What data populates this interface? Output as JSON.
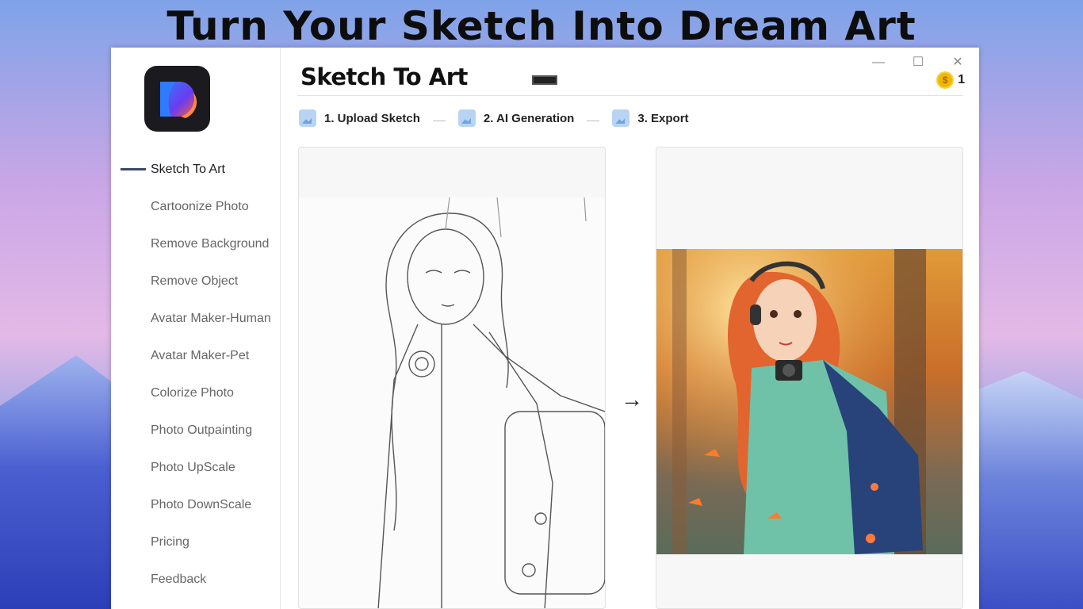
{
  "headline": "Turn Your Sketch Into Dream Art",
  "app": {
    "title": "Sketch To Art",
    "coins": "1",
    "coin_symbol": "$"
  },
  "window_controls": {
    "minimize": "—",
    "maximize": "☐",
    "close": "✕"
  },
  "sidebar": {
    "items": [
      {
        "label": "Sketch To Art",
        "active": true
      },
      {
        "label": "Cartoonize Photo"
      },
      {
        "label": "Remove Background"
      },
      {
        "label": "Remove Object"
      },
      {
        "label": "Avatar Maker-Human"
      },
      {
        "label": "Avatar Maker-Pet"
      },
      {
        "label": "Colorize Photo"
      },
      {
        "label": "Photo Outpainting"
      },
      {
        "label": "Photo UpScale"
      },
      {
        "label": "Photo DownScale"
      },
      {
        "label": "Pricing"
      },
      {
        "label": "Feedback"
      }
    ]
  },
  "steps": [
    {
      "label": "1. Upload Sketch"
    },
    {
      "label": "2. AI Generation"
    },
    {
      "label": "3. Export"
    }
  ],
  "arrow": "→",
  "colors": {
    "accent": "#3c4a66",
    "coin": "#f2b705"
  }
}
